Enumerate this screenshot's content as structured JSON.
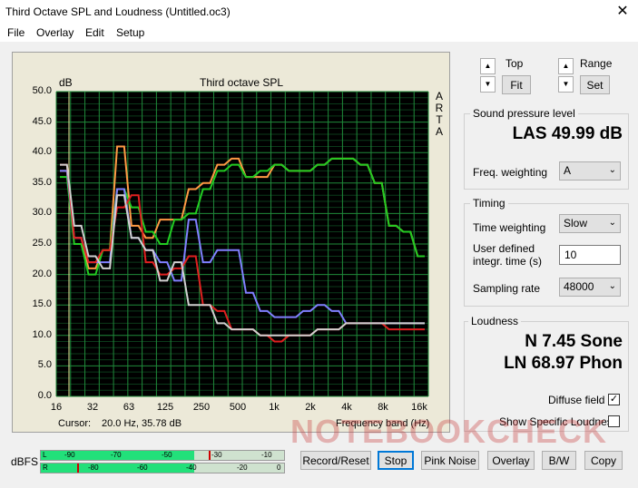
{
  "window": {
    "title": "Third Octave SPL and Loudness (Untitled.oc3)",
    "close_glyph": "✕"
  },
  "menu": [
    "File",
    "Overlay",
    "Edit",
    "Setup"
  ],
  "plot": {
    "title": "Third octave SPL",
    "y_unit": "dB",
    "arta": [
      "A",
      "R",
      "T",
      "A"
    ],
    "cursor_label": "Cursor:",
    "cursor_value": "20.0 Hz, 35.78 dB",
    "x_axis_label": "Frequency band (Hz)"
  },
  "chart_data": {
    "type": "line",
    "title": "Third octave SPL",
    "ylabel": "dB",
    "xlabel": "Frequency band (Hz)",
    "ylim": [
      0,
      50
    ],
    "y_ticks": [
      "50.0",
      "45.0",
      "40.0",
      "35.0",
      "30.0",
      "25.0",
      "20.0",
      "15.0",
      "10.0",
      "5.0",
      "0.0"
    ],
    "x_ticks": [
      "16",
      "32",
      "63",
      "125",
      "250",
      "500",
      "1k",
      "2k",
      "4k",
      "8k",
      "16k"
    ],
    "grid": true,
    "series": [
      {
        "color": "#ff9944",
        "values": [
          37,
          26,
          21,
          24,
          41,
          28,
          26,
          29,
          29,
          34,
          35,
          38,
          39,
          36,
          36,
          38,
          37,
          37,
          38,
          39,
          39,
          38,
          35,
          28,
          27,
          23
        ]
      },
      {
        "color": "#22cc22",
        "values": [
          36,
          25,
          20,
          24,
          34,
          31,
          27,
          25,
          29,
          30,
          34,
          37,
          38,
          36,
          37,
          38,
          37,
          37,
          38,
          39,
          39,
          38,
          35,
          28,
          27,
          23
        ]
      },
      {
        "color": "#8080ff",
        "values": [
          37,
          26,
          22,
          22,
          34,
          26,
          24,
          22,
          19,
          29,
          22,
          24,
          24,
          17,
          14,
          13,
          13,
          14,
          15,
          14,
          12,
          12,
          12,
          12,
          12,
          12
        ]
      },
      {
        "color": "#e02020",
        "values": [
          38,
          26,
          22,
          24,
          31,
          33,
          22,
          20,
          21,
          23,
          15,
          14,
          11,
          11,
          10,
          9,
          10,
          10,
          11,
          11,
          12,
          12,
          12,
          11,
          11,
          11
        ]
      },
      {
        "color": "#d0d0d0",
        "values": [
          38,
          28,
          23,
          21,
          33,
          26,
          24,
          19,
          22,
          15,
          15,
          12,
          11,
          11,
          10,
          10,
          10,
          10,
          11,
          11,
          12,
          12,
          12,
          12,
          12,
          12
        ]
      }
    ]
  },
  "right": {
    "top_label": "Top",
    "range_label": "Range",
    "fit": "Fit",
    "set": "Set",
    "spl_group": "Sound pressure level",
    "spl_value": "LAS 49.99 dB",
    "freq_weighting_label": "Freq. weighting",
    "freq_weighting_value": "A",
    "timing_group": "Timing",
    "time_weighting_label": "Time weighting",
    "time_weighting_value": "Slow",
    "user_time_label_1": "User defined",
    "user_time_label_2": "integr. time (s)",
    "user_time_value": "10",
    "sampling_rate_label": "Sampling rate",
    "sampling_rate_value": "48000",
    "loudness_group": "Loudness",
    "loudness_n": "N 7.45 Sone",
    "loudness_ln": "LN 68.97 Phon",
    "diffuse_field": "Diffuse field",
    "diffuse_checked": "✓",
    "show_specific": "Show Specific Loudness"
  },
  "meter": {
    "label": "dBFS",
    "row_l": "L",
    "row_r": "R",
    "l_ticks": [
      "-90",
      "-70",
      "-50",
      "-30",
      "-10"
    ],
    "r_ticks": [
      "-80",
      "-60",
      "-40",
      "-20",
      "0"
    ],
    "level": 0.63
  },
  "buttons": [
    "Record/Reset",
    "Stop",
    "Pink Noise",
    "Overlay",
    "B/W",
    "Copy"
  ],
  "watermark": "NOTEBOOKCHECK"
}
